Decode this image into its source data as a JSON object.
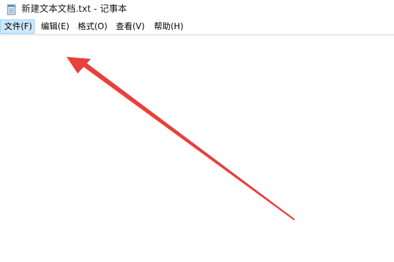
{
  "window": {
    "title": "新建文本文档.txt - 记事本"
  },
  "menubar": {
    "items": [
      {
        "label": "文件(F)"
      },
      {
        "label": "编辑(E)"
      },
      {
        "label": "格式(O)"
      },
      {
        "label": "查看(V)"
      },
      {
        "label": "帮助(H)"
      }
    ]
  },
  "editor": {
    "content": ""
  },
  "annotation": {
    "arrow_color": "#e8403a"
  },
  "colors": {
    "menu_active_bg": "#cce8ff",
    "menu_active_border": "#99d1ff"
  }
}
